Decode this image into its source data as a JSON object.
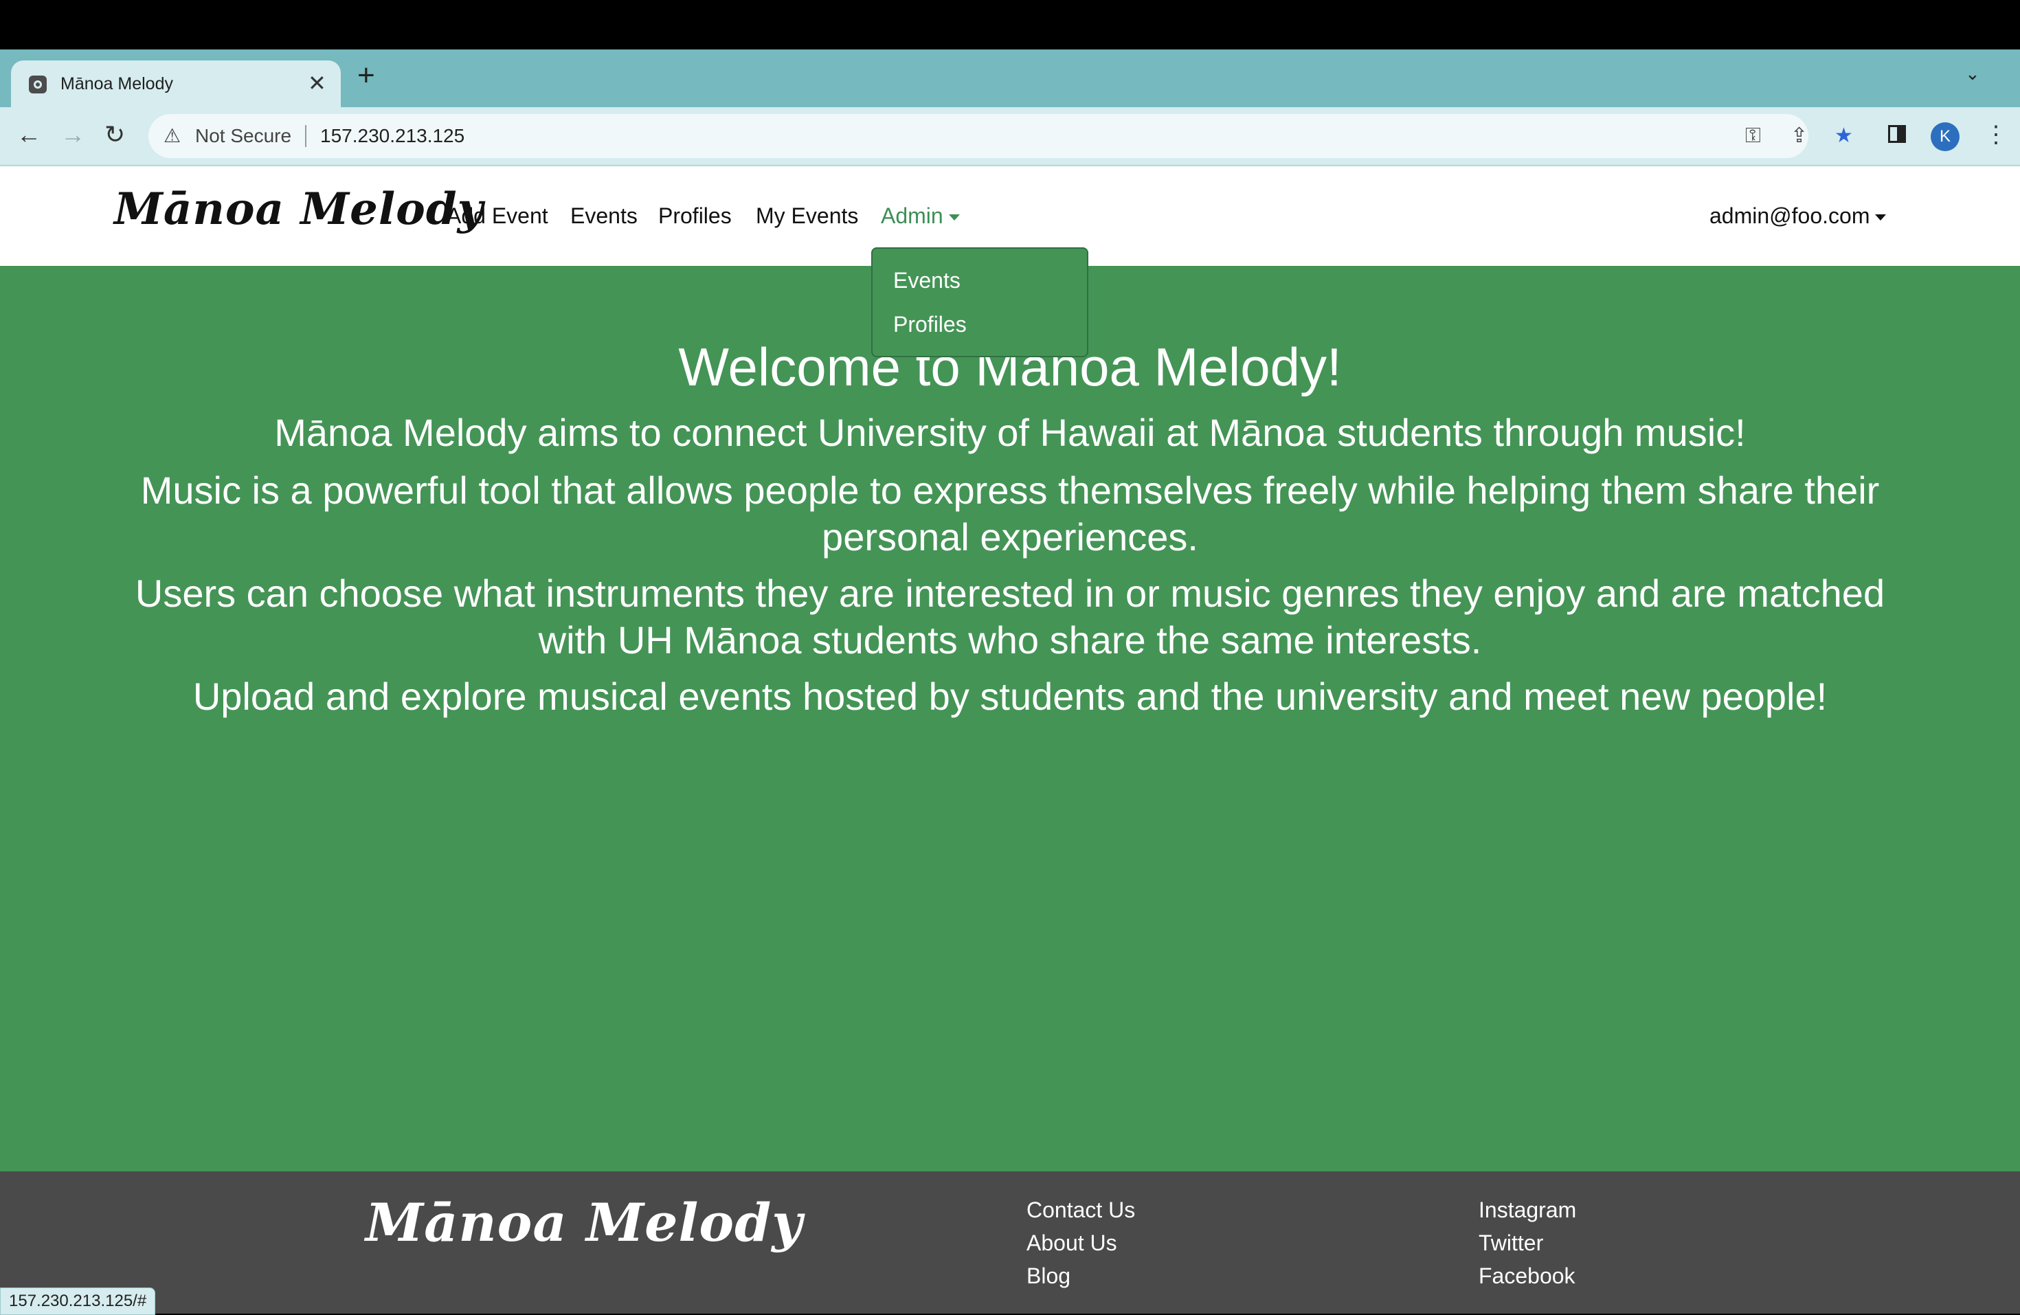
{
  "browser": {
    "tab_title": "Mānoa Melody",
    "tab_close": "✕",
    "new_tab": "+",
    "tab_list": "⌄",
    "nav": {
      "back": "←",
      "forward": "→",
      "reload": "↻"
    },
    "security_label": "Not Secure",
    "url": "157.230.213.125",
    "avatar_initial": "K",
    "status_url": "157.230.213.125/#"
  },
  "navbar": {
    "brand": "Mānoa Melody",
    "links": [
      "Add Event",
      "Events",
      "Profiles",
      "My Events"
    ],
    "admin_label": "Admin",
    "admin_menu": [
      "Events",
      "Profiles"
    ],
    "user_label": "admin@foo.com"
  },
  "main": {
    "heading": "Welcome to Mānoa Melody!",
    "paragraphs": [
      "Mānoa Melody aims to connect University of Hawaii at Mānoa students through music!",
      "Music is a powerful tool that allows people to express themselves freely while helping them share their personal experiences.",
      "Users can choose what instruments they are interested in or music genres they enjoy and are matched with UH Mānoa students who share the same interests.",
      "Upload and explore musical events hosted by students and the university and meet new people!"
    ]
  },
  "footer": {
    "brand": "Mānoa Melody",
    "col1": [
      "Contact Us",
      "About Us",
      "Blog"
    ],
    "col2": [
      "Instagram",
      "Twitter",
      "Facebook"
    ]
  },
  "colors": {
    "main_bg": "#449456",
    "footer_bg": "#4a4a4a",
    "tabstrip_bg": "#76b9bf",
    "toolbar_bg": "#d6ecee",
    "admin_link": "#3d8f56",
    "star_blue": "#2f64d8"
  }
}
